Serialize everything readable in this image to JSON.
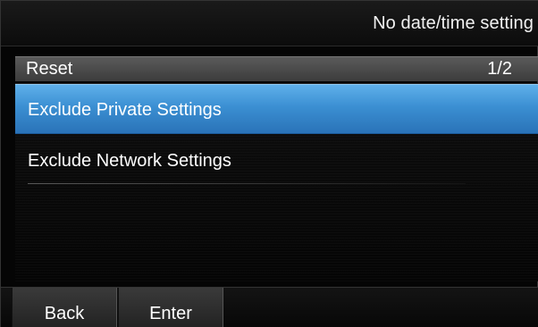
{
  "status_bar": {
    "text": "No date/time setting"
  },
  "menu": {
    "title": "Reset",
    "page_indicator": "1/2",
    "items": [
      {
        "label": "Exclude Private Settings",
        "selected": true
      },
      {
        "label": "Exclude Network Settings",
        "selected": false
      }
    ]
  },
  "soft_keys": {
    "back_label": "Back",
    "enter_label": "Enter"
  },
  "colors": {
    "selection_highlight": "#3b8fd2",
    "background": "#050505",
    "header": "#4a4a4a"
  }
}
